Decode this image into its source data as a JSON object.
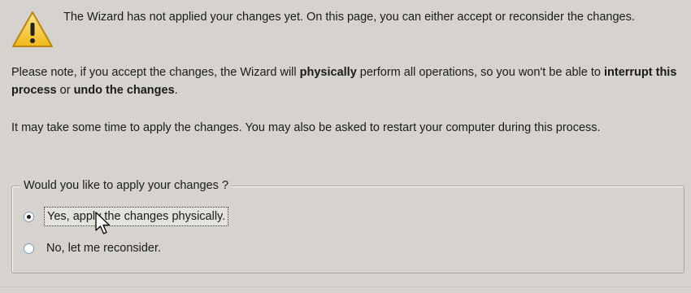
{
  "warning": {
    "icon": "warning-icon",
    "text": "The Wizard has not applied your changes yet. On this page, you can either accept or reconsider the changes."
  },
  "note": {
    "part1": "Please note, if you accept the changes, the Wizard will ",
    "bold1": "physically",
    "part2": " perform all operations, so you won't be able to ",
    "bold2": "interrupt this process",
    "part3": " or ",
    "bold3": "undo the changes",
    "part4": "."
  },
  "info": {
    "text": "It may take some time to apply the changes. You may also be asked to restart your computer during this process."
  },
  "apply_group": {
    "title": "Would you like to apply your changes ?",
    "options": [
      {
        "label": "Yes, apply the changes physically.",
        "selected": true
      },
      {
        "label": "No, let me reconsider.",
        "selected": false
      }
    ]
  },
  "colors": {
    "background": "#d6d3ce",
    "warning_fill": "#f5c518"
  }
}
